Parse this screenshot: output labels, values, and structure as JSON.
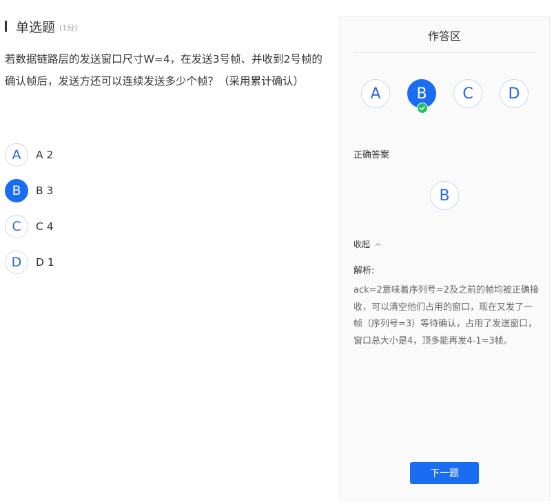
{
  "question": {
    "type_label": "单选题",
    "score": "(1分)",
    "text": "若数据链路层的发送窗口尺寸W=4，在发送3号帧、并收到2号帧的确认帧后，发送方还可以连续发送多少个帧？（采用累计确认）",
    "options": [
      {
        "letter": "A",
        "text": "A 2",
        "selected": false
      },
      {
        "letter": "B",
        "text": "B 3",
        "selected": true
      },
      {
        "letter": "C",
        "text": "C 4",
        "selected": false
      },
      {
        "letter": "D",
        "text": "D 1",
        "selected": false
      }
    ]
  },
  "answer_panel": {
    "title": "作答区",
    "choices": [
      {
        "letter": "A",
        "selected": false
      },
      {
        "letter": "B",
        "selected": true,
        "correct": true
      },
      {
        "letter": "C",
        "selected": false
      },
      {
        "letter": "D",
        "selected": false
      }
    ],
    "correct_answer_label": "正确答案",
    "correct_answer": "B",
    "collapse_label": "收起",
    "explanation_label": "解析:",
    "explanation": "ack=2意味着序列号=2及之前的帧均被正确接收，可以清空他们占用的窗口，现在又发了一帧（序列号=3）等待确认，占用了发送窗口，窗口总大小是4，顶多能再发4-1=3帧。",
    "next_button": "下一题"
  },
  "icons": {
    "check": "check-circle-icon",
    "collapse": "chevron-up-icon"
  },
  "colors": {
    "primary": "#1a6cf2",
    "success": "#22c25e",
    "option_letter": "#2a66dd"
  }
}
